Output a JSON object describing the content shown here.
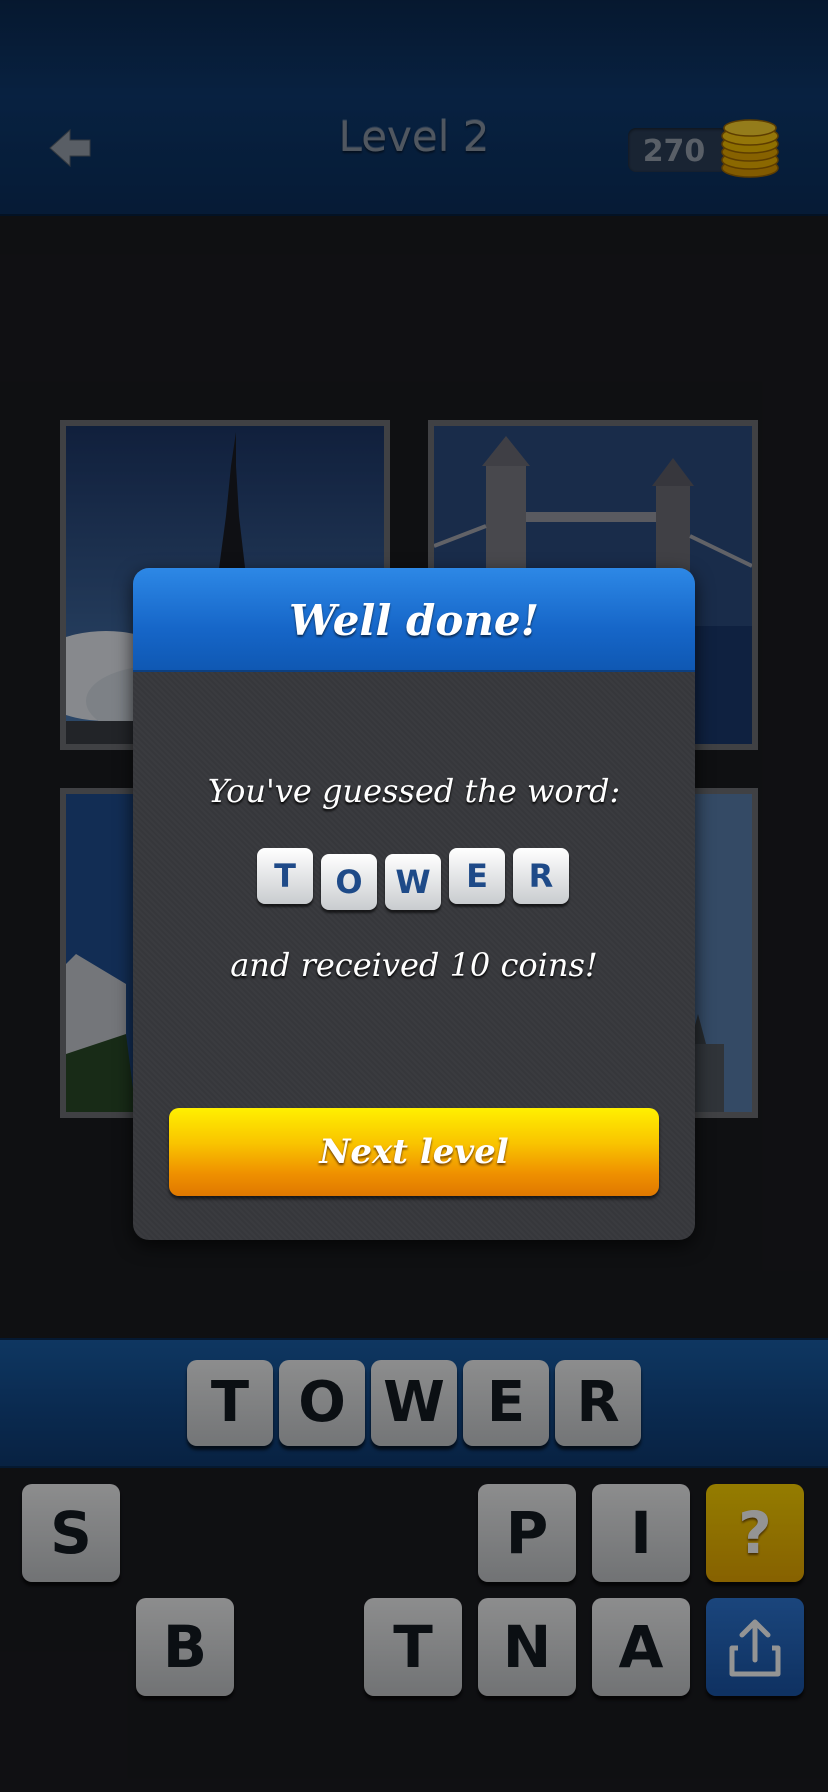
{
  "header": {
    "title": "Level 2",
    "coins": "270",
    "back_icon": "back-arrow-icon",
    "coins_icon": "coin-stack-icon"
  },
  "photos": [
    "eiffel-tower-photo",
    "tower-bridge-photo",
    "leaning-tower-photo",
    "tower-photo"
  ],
  "dialog": {
    "title": "Well done!",
    "message": "You've guessed the word:",
    "word_letters": [
      "T",
      "O",
      "W",
      "E",
      "R"
    ],
    "reward": "and received 10 coins!",
    "next_label": "Next level"
  },
  "answer": {
    "letters": [
      "T",
      "O",
      "W",
      "E",
      "R"
    ]
  },
  "keyboard": {
    "row1": [
      "S",
      "P",
      "I"
    ],
    "row2": [
      "B",
      "T",
      "N",
      "A"
    ],
    "hint_label": "?",
    "share_icon": "share-icon"
  },
  "colors": {
    "header_blue": "#0e3a70",
    "dialog_blue": "#1666c8",
    "button_yellow": "#f9c400",
    "button_orange": "#e07800"
  }
}
